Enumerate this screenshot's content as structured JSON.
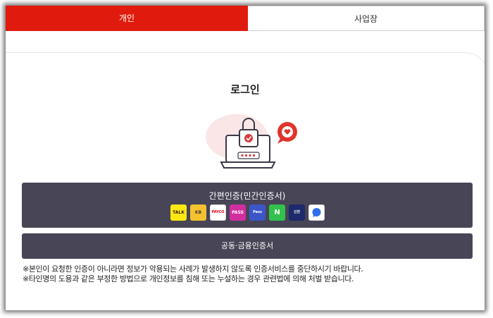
{
  "tabs": [
    {
      "label": "개인",
      "active": true
    },
    {
      "label": "사업장",
      "active": false
    }
  ],
  "login": {
    "title": "로그인"
  },
  "simple_auth": {
    "label": "간편인증(민간인증서)",
    "providers": [
      {
        "name": "kakao-icon",
        "text": "TALK"
      },
      {
        "name": "kb-icon",
        "text": "KB"
      },
      {
        "name": "payco-icon",
        "text": "PAYCO"
      },
      {
        "name": "pass-icon",
        "text": "PASS"
      },
      {
        "name": "samsung-pass-icon",
        "text": "Pass"
      },
      {
        "name": "naver-icon",
        "text": "N"
      },
      {
        "name": "shinhan-icon",
        "text": "신한"
      },
      {
        "name": "toss-icon",
        "text": ""
      }
    ]
  },
  "joint_cert": {
    "label": "공동·금융인증서"
  },
  "notices": [
    "※본인이 요청한 인증이 아니라면 정보가 악용되는 사례가 발생하지 않도록 인증서비스를 중단하시기 바랍니다.",
    "※타인명의 도용과 같은 부정한 방법으로 개인정보를 침해 또는 누설하는 경우 관련법에 의해 처벌 받습니다."
  ],
  "colors": {
    "accent": "#e01b0e",
    "button": "#474556"
  }
}
